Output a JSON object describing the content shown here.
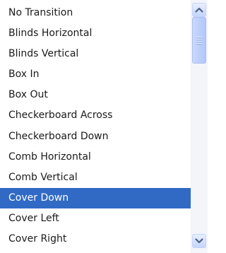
{
  "list": {
    "items": [
      {
        "label": "No Transition"
      },
      {
        "label": "Blinds Horizontal"
      },
      {
        "label": "Blinds Vertical"
      },
      {
        "label": "Box In"
      },
      {
        "label": "Box Out"
      },
      {
        "label": "Checkerboard Across"
      },
      {
        "label": "Checkerboard Down"
      },
      {
        "label": "Comb Horizontal"
      },
      {
        "label": "Comb Vertical"
      },
      {
        "label": "Cover Down"
      },
      {
        "label": "Cover Left"
      },
      {
        "label": "Cover Right"
      }
    ],
    "selected_label": "Cover Down"
  },
  "scrollbar": {
    "up_icon": "chevron-up-icon",
    "down_icon": "chevron-down-icon",
    "thumb_grip_icon": "grip-icon"
  },
  "colors": {
    "selection_bg": "#316ac5",
    "selection_text": "#ffffff",
    "text": "#1a1a1a",
    "arrow": "#4d6185"
  }
}
